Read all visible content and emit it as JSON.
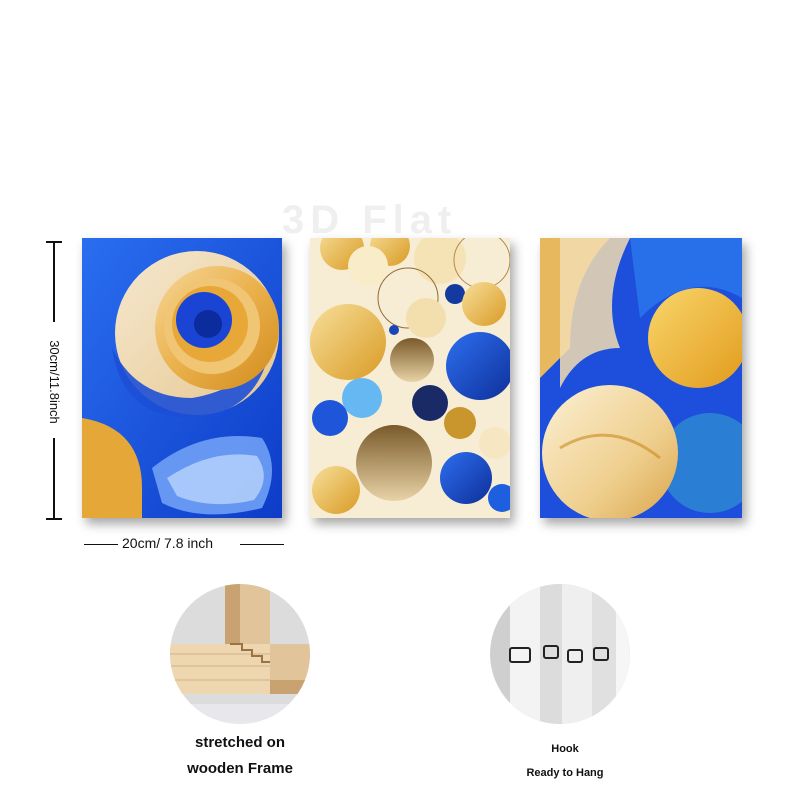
{
  "watermark": "3D Flat",
  "dimensions": {
    "height_label": "30cm/11.8inch",
    "width_label": "20cm/ 7.8 inch"
  },
  "features": [
    {
      "line1": "stretched on",
      "line2": "wooden Frame",
      "icon": "wooden-frame-corner-icon"
    },
    {
      "line1": "Hook",
      "line2": "Ready to Hang",
      "icon": "hanging-hook-icon"
    }
  ],
  "colors": {
    "royal_blue": "#1f4fd8",
    "gold": "#e8a92c",
    "cream": "#f4e6c6",
    "navy": "#0f2a7a",
    "sky_blue": "#55b3f0"
  }
}
